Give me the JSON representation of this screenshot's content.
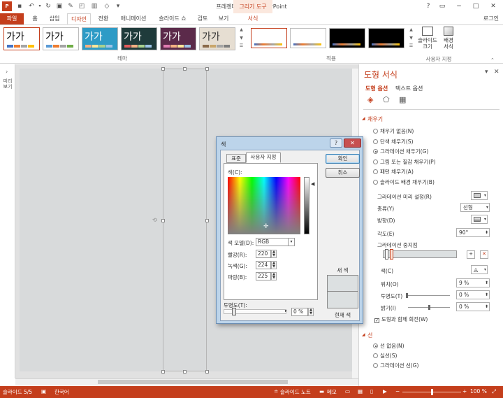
{
  "app": {
    "title": "프레젠테이션1 - PowerPoint",
    "context_tab_group": "그리기 도구",
    "login": "로그인",
    "accent": "#c43e1c"
  },
  "quick_access": {
    "icons": [
      "powerpoint-logo-icon",
      "save-icon",
      "undo-icon",
      "undo-dropdown-icon",
      "redo-icon",
      "start-slideshow-icon",
      "format-painter-icon",
      "shapes-icon",
      "group-icon",
      "more-icon"
    ]
  },
  "window_controls": [
    "?",
    "restore",
    "−",
    "□",
    "✕"
  ],
  "tabs": [
    "파일",
    "홈",
    "삽입",
    "디자인",
    "전환",
    "애니메이션",
    "슬라이드 쇼",
    "검토",
    "보기",
    "서식"
  ],
  "active_tab": "디자인",
  "ribbon": {
    "themes_group_label": "테마",
    "variants_group_label": "적용",
    "custom_group_label": "사용자 지정",
    "theme_sample_text": "가가",
    "slide_size_label": "슬라이드\n크기",
    "background_format_label": "배경\n서식",
    "themes": [
      {
        "bg": "#ffffff",
        "fg": "#000000",
        "bar": [
          "#4472c4",
          "#ed7d31",
          "#a5a5a5",
          "#ffc000"
        ]
      },
      {
        "bg": "#ffffff",
        "fg": "#000000",
        "bar": [
          "#5b9bd5",
          "#ed7d31",
          "#a5a5a5",
          "#70ad47"
        ]
      },
      {
        "bg": "#2e9bc6",
        "fg": "#ffffff",
        "bar": [
          "#f4b183",
          "#ffe699",
          "#a9d18e",
          "#9dc3e6"
        ]
      },
      {
        "bg": "#1f3b3b",
        "fg": "#ffffff",
        "bar": [
          "#e05c5c",
          "#f4b183",
          "#a9d18e",
          "#9dc3e6"
        ]
      },
      {
        "bg": "#5b2a4a",
        "fg": "#ffffff",
        "bar": [
          "#e07bb0",
          "#f4b183",
          "#ffe699",
          "#9dc3e6"
        ]
      },
      {
        "bg": "#e6ded2",
        "fg": "#333333",
        "bar": [
          "#8b6a4a",
          "#c9a66b",
          "#a5a5a5",
          "#7f7f7f"
        ]
      }
    ],
    "variants": [
      "#ffffff",
      "#ffffff",
      "#000000",
      "#000000"
    ]
  },
  "thumb_strip_label": "미리보기",
  "pane": {
    "title": "도형 서식",
    "tabs": [
      "도형 옵션",
      "텍스트 옵션"
    ],
    "fill_section": "채우기",
    "fill_options": [
      {
        "label": "채우기 없음(N)",
        "selected": false
      },
      {
        "label": "단색 채우기(S)",
        "selected": false
      },
      {
        "label": "그라데이션 채우기(G)",
        "selected": true
      },
      {
        "label": "그림 또는 질감 채우기(P)",
        "selected": false
      },
      {
        "label": "패턴 채우기(A)",
        "selected": false
      },
      {
        "label": "슬라이드 배경 채우기(B)",
        "selected": false
      }
    ],
    "preset_label": "그라데이션 미리 설정(R)",
    "type_label": "종류(Y)",
    "type_value": "선형",
    "direction_label": "방향(D)",
    "angle_label": "각도(E)",
    "angle_value": "90°",
    "stops_label": "그라데이션 중지점",
    "color_label": "색(C)",
    "position_label": "위치(O)",
    "position_value": "9 %",
    "transparency_label": "투명도(T)",
    "transparency_value": "0 %",
    "brightness_label": "밝기(I)",
    "brightness_value": "0 %",
    "rotate_with_shape": "도형과 함께 회전(W)",
    "line_section": "선",
    "line_options": [
      {
        "label": "선 없음(N)",
        "selected": true
      },
      {
        "label": "실선(S)",
        "selected": false
      },
      {
        "label": "그라데이션 선(G)",
        "selected": false
      }
    ]
  },
  "dialog": {
    "title": "색",
    "tabs": [
      "표준",
      "사용자 지정"
    ],
    "active_tab": "사용자 지정",
    "colors_label": "색(C):",
    "model_label": "색 모델(D):",
    "model_value": "RGB",
    "red_label": "빨강(R):",
    "red_value": "220",
    "green_label": "녹색(G):",
    "green_value": "224",
    "blue_label": "파랑(B):",
    "blue_value": "225",
    "transparency_label": "투명도(T):",
    "transparency_value": "0 %",
    "ok": "확인",
    "cancel": "취소",
    "new_label": "새 색",
    "current_label": "현재 색",
    "new_color": "#dce0e1",
    "current_color": "#dce0e1"
  },
  "status": {
    "slide": "슬라이드 5/5",
    "language": "한국어",
    "notes": "슬라이드 노트",
    "comments": "메모",
    "zoom": "100 %"
  }
}
